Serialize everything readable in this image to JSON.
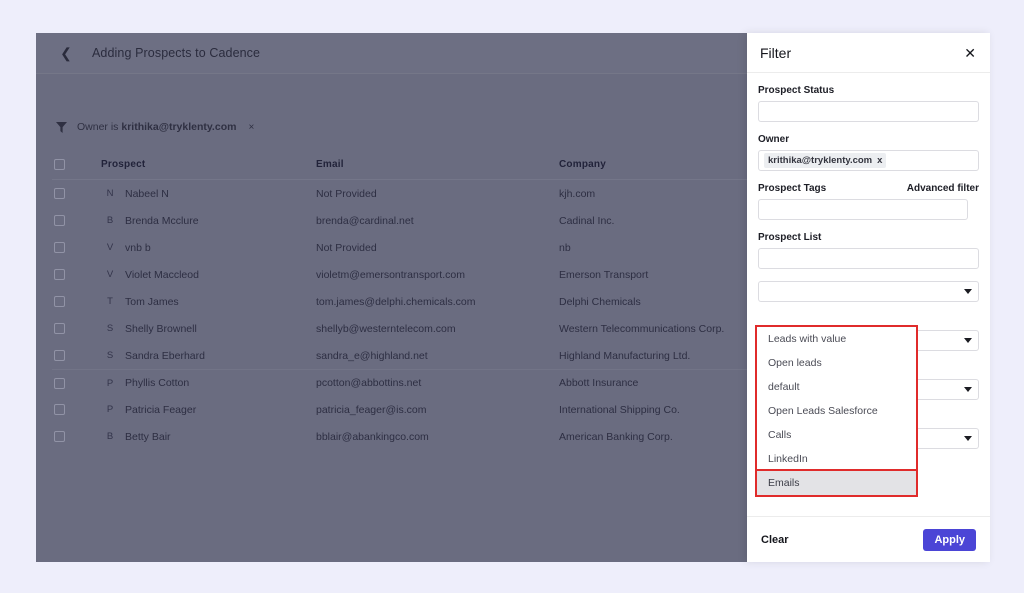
{
  "app": {
    "title": "Adding Prospects to Cadence",
    "back_icon": "chevron-left-icon"
  },
  "filter_chip": {
    "icon": "funnel-icon",
    "prefix": "Owner is",
    "value": "krithika@tryklenty.com",
    "remove": "×"
  },
  "table": {
    "columns": [
      "Prospect",
      "Email",
      "Company"
    ],
    "rows": [
      {
        "initial": "N",
        "prospect": "Nabeel N",
        "email": "Not Provided",
        "company": "kjh.com"
      },
      {
        "initial": "B",
        "prospect": "Brenda Mcclure",
        "email": "brenda@cardinal.net",
        "company": "Cadinal Inc."
      },
      {
        "initial": "V",
        "prospect": "vnb b",
        "email": "Not Provided",
        "company": "nb"
      },
      {
        "initial": "V",
        "prospect": "Violet Maccleod",
        "email": "violetm@emersontransport.com",
        "company": "Emerson Transport"
      },
      {
        "initial": "T",
        "prospect": "Tom James",
        "email": "tom.james@delphi.chemicals.com",
        "company": "Delphi Chemicals"
      },
      {
        "initial": "S",
        "prospect": "Shelly Brownell",
        "email": "shellyb@westerntelecom.com",
        "company": "Western Telecommunications Corp."
      },
      {
        "initial": "S",
        "prospect": "Sandra Eberhard",
        "email": "sandra_e@highland.net",
        "company": "Highland Manufacturing Ltd."
      },
      {
        "initial": "P",
        "prospect": "Phyllis Cotton",
        "email": "pcotton@abbottins.net",
        "company": "Abbott Insurance"
      },
      {
        "initial": "P",
        "prospect": "Patricia Feager",
        "email": "patricia_feager@is.com",
        "company": "International Shipping Co."
      },
      {
        "initial": "B",
        "prospect": "Betty Bair",
        "email": "bblair@abankingco.com",
        "company": "American Banking Corp."
      }
    ]
  },
  "panel": {
    "title": "Filter",
    "close_icon": "close-icon",
    "fields": {
      "prospect_status_label": "Prospect Status",
      "prospect_status_value": "",
      "owner_label": "Owner",
      "owner_token": "krithika@tryklenty.com",
      "owner_token_remove": "x",
      "prospect_tags_label": "Prospect Tags",
      "advanced_filter_label": "Advanced filter",
      "prospect_tags_value": "",
      "prospect_list_label": "Prospect List",
      "prospect_list_value": ""
    },
    "dropdown": {
      "options": [
        "Leads with value",
        "Open leads",
        "default",
        "Open Leads Salesforce",
        "Calls",
        "LinkedIn",
        "Emails"
      ],
      "selected": "Emails",
      "highlight_color": "#e02b2b"
    },
    "footer": {
      "clear_label": "Clear",
      "apply_label": "Apply",
      "apply_color": "#4b45d6"
    }
  }
}
